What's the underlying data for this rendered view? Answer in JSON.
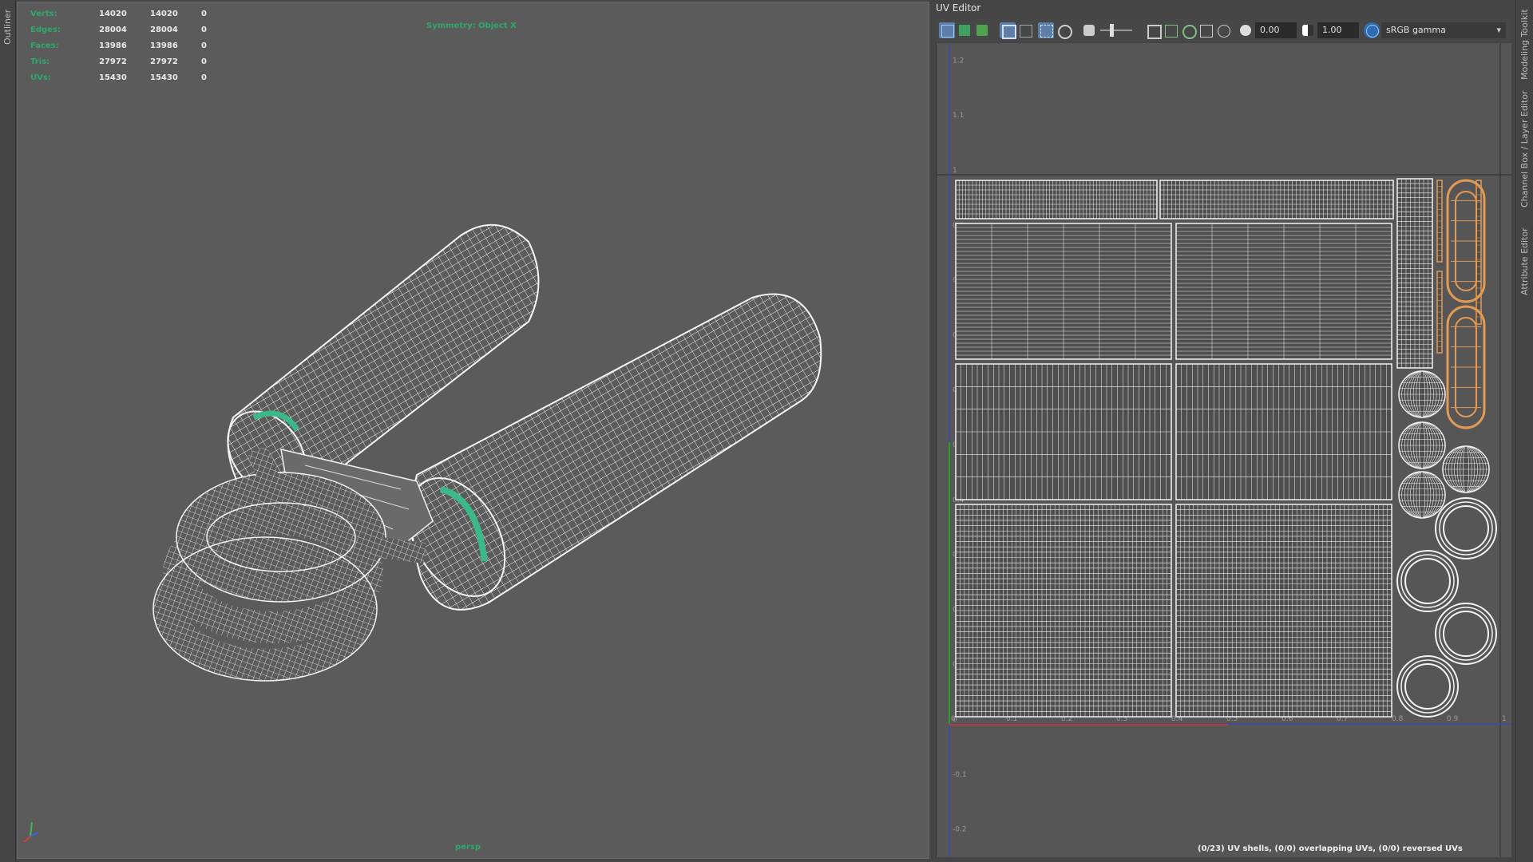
{
  "side_tabs": {
    "outliner": "Outliner",
    "modeling_toolkit": "Modeling Toolkit",
    "channel_box": "Channel Box / Layer Editor",
    "attribute_editor": "Attribute Editor"
  },
  "viewport": {
    "camera": "persp",
    "symmetry": "Symmetry: Object X",
    "hud_rows": [
      {
        "label": "Verts:",
        "v1": "14020",
        "v2": "14020",
        "v3": "0"
      },
      {
        "label": "Edges:",
        "v1": "28004",
        "v2": "28004",
        "v3": "0"
      },
      {
        "label": "Faces:",
        "v1": "13986",
        "v2": "13986",
        "v3": "0"
      },
      {
        "label": "Tris:",
        "v1": "27972",
        "v2": "27972",
        "v3": "0"
      },
      {
        "label": "UVs:",
        "v1": "15430",
        "v2": "15430",
        "v3": "0"
      }
    ]
  },
  "uv_editor": {
    "title": "UV Editor",
    "exposure_value": "0.00",
    "gamma_value": "1.00",
    "color_space": "sRGB gamma",
    "status": "(0/23) UV shells, (0/0) overlapping UVs, (0/0) reversed UVs",
    "v_ticks": [
      "1.2",
      "1.1",
      "1",
      "0.9",
      "0.8",
      "0.7",
      "0.6",
      "0.5",
      "0.4",
      "0.3",
      "0.2",
      "0.1",
      "0",
      "-0.1",
      "-0.2"
    ],
    "u_ticks": [
      "0",
      "0.1",
      "0.2",
      "0.3",
      "0.4",
      "0.5",
      "0.6",
      "0.7",
      "0.8",
      "0.9",
      "1"
    ]
  },
  "colors": {
    "hud_green": "#2fa86a",
    "wire": "#f2f2f2",
    "selected_shell": "#e39a55",
    "u_axis": "#c0392b",
    "v_axis": "#3344cc"
  }
}
